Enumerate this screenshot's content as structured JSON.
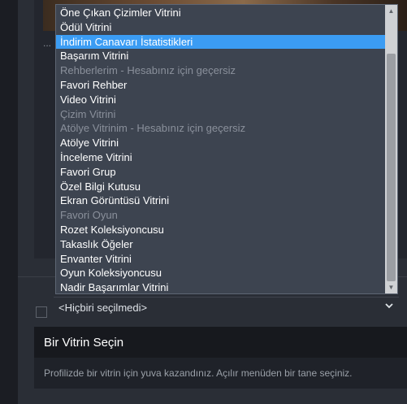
{
  "artwork": {
    "caption": "..."
  },
  "showcase_select": {
    "options": [
      {
        "label": "Öne Çıkan Çizimler Vitrini",
        "disabled": false,
        "selected": false
      },
      {
        "label": "Ödül Vitrini",
        "disabled": false,
        "selected": false
      },
      {
        "label": "İndirim Canavarı İstatistikleri",
        "disabled": false,
        "selected": true
      },
      {
        "label": "Başarım Vitrini",
        "disabled": false,
        "selected": false
      },
      {
        "label": "Rehberlerim - Hesabınız için geçersiz",
        "disabled": true,
        "selected": false
      },
      {
        "label": "Favori Rehber",
        "disabled": false,
        "selected": false
      },
      {
        "label": "Video Vitrini",
        "disabled": false,
        "selected": false
      },
      {
        "label": "Çizim Vitrini",
        "disabled": true,
        "selected": false
      },
      {
        "label": "Atölye Vitrinim - Hesabınız için geçersiz",
        "disabled": true,
        "selected": false
      },
      {
        "label": "Atölye Vitrini",
        "disabled": false,
        "selected": false
      },
      {
        "label": "İnceleme Vitrini",
        "disabled": false,
        "selected": false
      },
      {
        "label": "Favori Grup",
        "disabled": false,
        "selected": false
      },
      {
        "label": "Özel Bilgi Kutusu",
        "disabled": false,
        "selected": false
      },
      {
        "label": "Ekran Görüntüsü Vitrini",
        "disabled": false,
        "selected": false
      },
      {
        "label": "Favori Oyun",
        "disabled": true,
        "selected": false
      },
      {
        "label": "Rozet Koleksiyoncusu",
        "disabled": false,
        "selected": false
      },
      {
        "label": "Takaslık Öğeler",
        "disabled": false,
        "selected": false
      },
      {
        "label": "Envanter Vitrini",
        "disabled": false,
        "selected": false
      },
      {
        "label": "Oyun Koleksiyoncusu",
        "disabled": false,
        "selected": false
      },
      {
        "label": "Nadir Başarımlar Vitrini",
        "disabled": false,
        "selected": false
      }
    ],
    "current_value": "<Hiçbiri seçilmedi>",
    "chevron_icon": "chevron-down-icon"
  },
  "scrollbar": {
    "up_icon": "scroll-up-arrow-icon",
    "down_icon": "scroll-down-arrow-icon",
    "up_glyph": "▲",
    "down_glyph": "▼"
  },
  "info_card": {
    "title": "Bir Vitrin Seçin",
    "description": "Profilizde bir vitrin için yuva kazandınız. Açılır menüden bir tane seçiniz."
  },
  "colors": {
    "highlight": "#3b9cf3",
    "listbox_bg": "#3d4450",
    "disabled_text": "#8a909b",
    "page_bg": "#2a2e36"
  }
}
